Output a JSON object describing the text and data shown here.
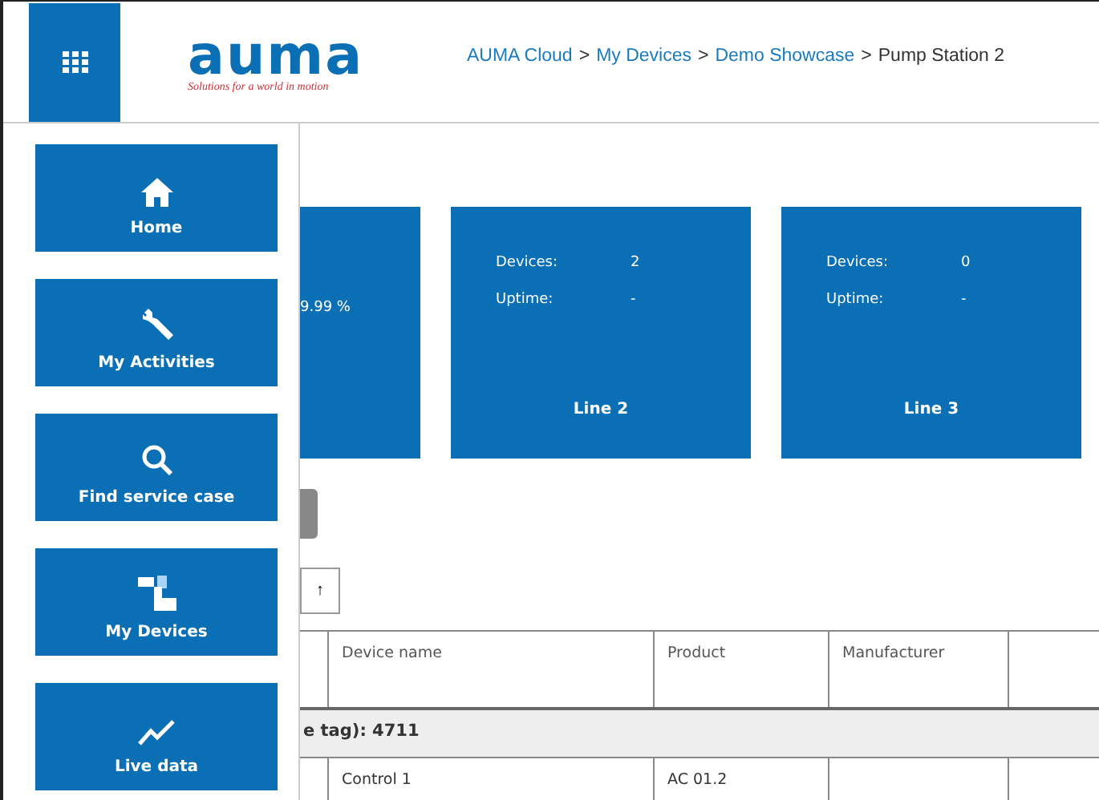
{
  "header": {
    "logo": {
      "wordmark": "auma",
      "tagline": "Solutions for a world in motion"
    },
    "breadcrumb_separator": ">",
    "breadcrumb": [
      {
        "label": "AUMA Cloud",
        "kind": "link"
      },
      {
        "label": "My Devices",
        "kind": "link"
      },
      {
        "label": "Demo Showcase",
        "kind": "link"
      },
      {
        "label": "Pump Station 2",
        "kind": "current"
      }
    ]
  },
  "menu": [
    {
      "label": "Home",
      "kind": "home"
    },
    {
      "label": "My Activities",
      "kind": "wrench"
    },
    {
      "label": "Find service case",
      "kind": "search"
    },
    {
      "label": "My Devices",
      "kind": "devices"
    },
    {
      "label": "Live data",
      "kind": "chart"
    }
  ],
  "cards": [
    {
      "kind": "cut",
      "uptime_value": "9.99 %"
    },
    {
      "kind": "full",
      "devices_label": "Devices:",
      "devices_value": "2",
      "uptime_label": "Uptime:",
      "uptime_value": "-",
      "title": "Line 2"
    },
    {
      "kind": "full",
      "devices_label": "Devices:",
      "devices_value": "0",
      "uptime_label": "Uptime:",
      "uptime_value": "-",
      "title": "Line 3"
    }
  ],
  "sort_button": "↑",
  "table": {
    "columns": [
      "Device name",
      "Product",
      "Manufacturer"
    ],
    "group": "e tag): 4711",
    "rows": [
      {
        "device_name": "Control 1",
        "product": "AC 01.2"
      }
    ]
  }
}
